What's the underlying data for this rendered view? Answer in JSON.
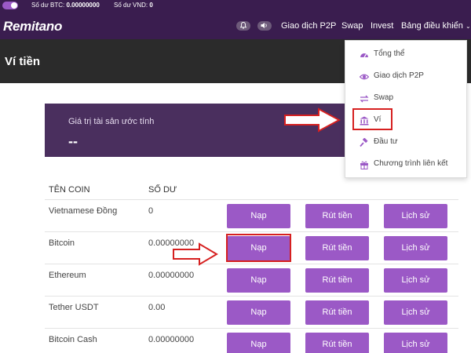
{
  "topbar": {
    "btc_label": "Số dư BTC:",
    "btc_value": "0.00000000",
    "vnd_label": "Số dư VND:",
    "vnd_value": "0"
  },
  "nav": {
    "logo": "Remitano",
    "p2p": "Giao dịch P2P",
    "swap": "Swap",
    "invest": "Invest",
    "dashboard": "Bảng điều khiển",
    "bell_icon": "bell-icon",
    "sound_icon": "speaker-icon"
  },
  "page": {
    "title": "Ví tiền"
  },
  "estimate": {
    "label": "Giá trị tài sản ước tính",
    "value": "--"
  },
  "table": {
    "headers": [
      "TÊN COIN",
      "SỐ DƯ"
    ],
    "deposit_label": "Nạp",
    "withdraw_label": "Rút tiền",
    "history_label": "Lịch sử",
    "rows": [
      {
        "name": "Vietnamese Đồng",
        "balance": "0"
      },
      {
        "name": "Bitcoin",
        "balance": "0.00000000"
      },
      {
        "name": "Ethereum",
        "balance": "0.00000000"
      },
      {
        "name": "Tether USDT",
        "balance": "0.00"
      },
      {
        "name": "Bitcoin Cash",
        "balance": "0.00000000"
      }
    ]
  },
  "dropdown": {
    "items": [
      {
        "label": "Tổng thể",
        "icon": "gauge-icon"
      },
      {
        "label": "Giao dịch P2P",
        "icon": "eye-icon"
      },
      {
        "label": "Swap",
        "icon": "swap-arrows-icon"
      },
      {
        "label": "Ví",
        "icon": "bank-icon"
      },
      {
        "label": "Đầu tư",
        "icon": "gavel-icon"
      },
      {
        "label": "Chương trình liên kết",
        "icon": "gift-icon"
      }
    ]
  },
  "colors": {
    "brand_purple": "#3a1d4f",
    "button_purple": "#9b59c6",
    "highlight_red": "#d62020"
  }
}
